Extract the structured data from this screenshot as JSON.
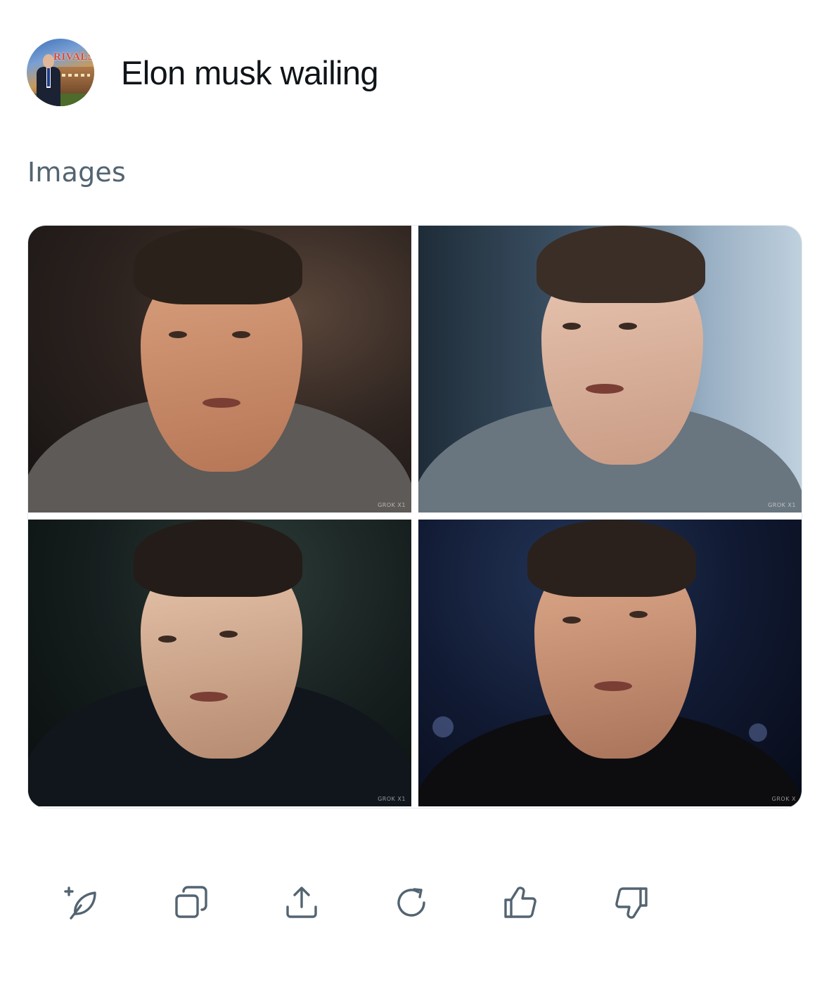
{
  "post": {
    "title": "Elon musk wailing",
    "avatar_text": "RIVALS"
  },
  "section": {
    "label": "Images"
  },
  "images": [
    {
      "watermark": "GROK X1"
    },
    {
      "watermark": "GROK X1"
    },
    {
      "watermark": "GROK X1"
    },
    {
      "watermark": "GROK X"
    }
  ],
  "actions": [
    {
      "icon": "new-post-icon"
    },
    {
      "icon": "copy-icon"
    },
    {
      "icon": "share-icon"
    },
    {
      "icon": "regenerate-icon"
    },
    {
      "icon": "thumbs-up-icon"
    },
    {
      "icon": "thumbs-down-icon"
    }
  ],
  "colors": {
    "title": "#0f1419",
    "secondary": "#536471",
    "background": "#ffffff"
  }
}
